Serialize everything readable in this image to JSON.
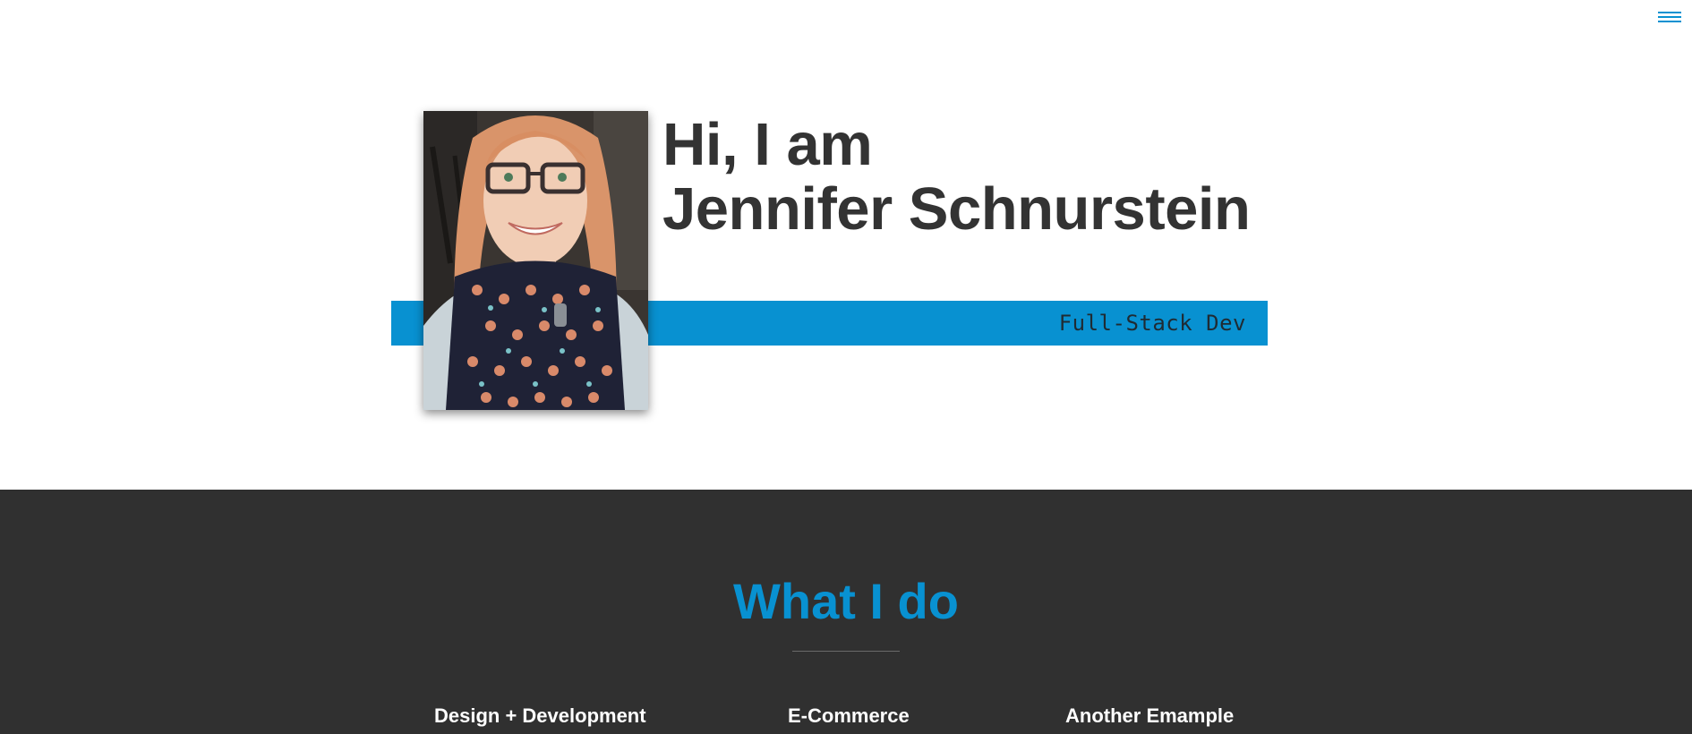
{
  "header": {
    "menu_icon": "hamburger-menu-icon"
  },
  "hero": {
    "greeting": "Hi, I am",
    "name": "Jennifer Schnurstein",
    "role": "Full-Stack Dev",
    "accent_color": "#0891d1"
  },
  "services": {
    "title": "What I do",
    "items": [
      {
        "label": "Design + Development"
      },
      {
        "label": "E-Commerce"
      },
      {
        "label": "Another Emample"
      }
    ],
    "background": "#303030"
  }
}
